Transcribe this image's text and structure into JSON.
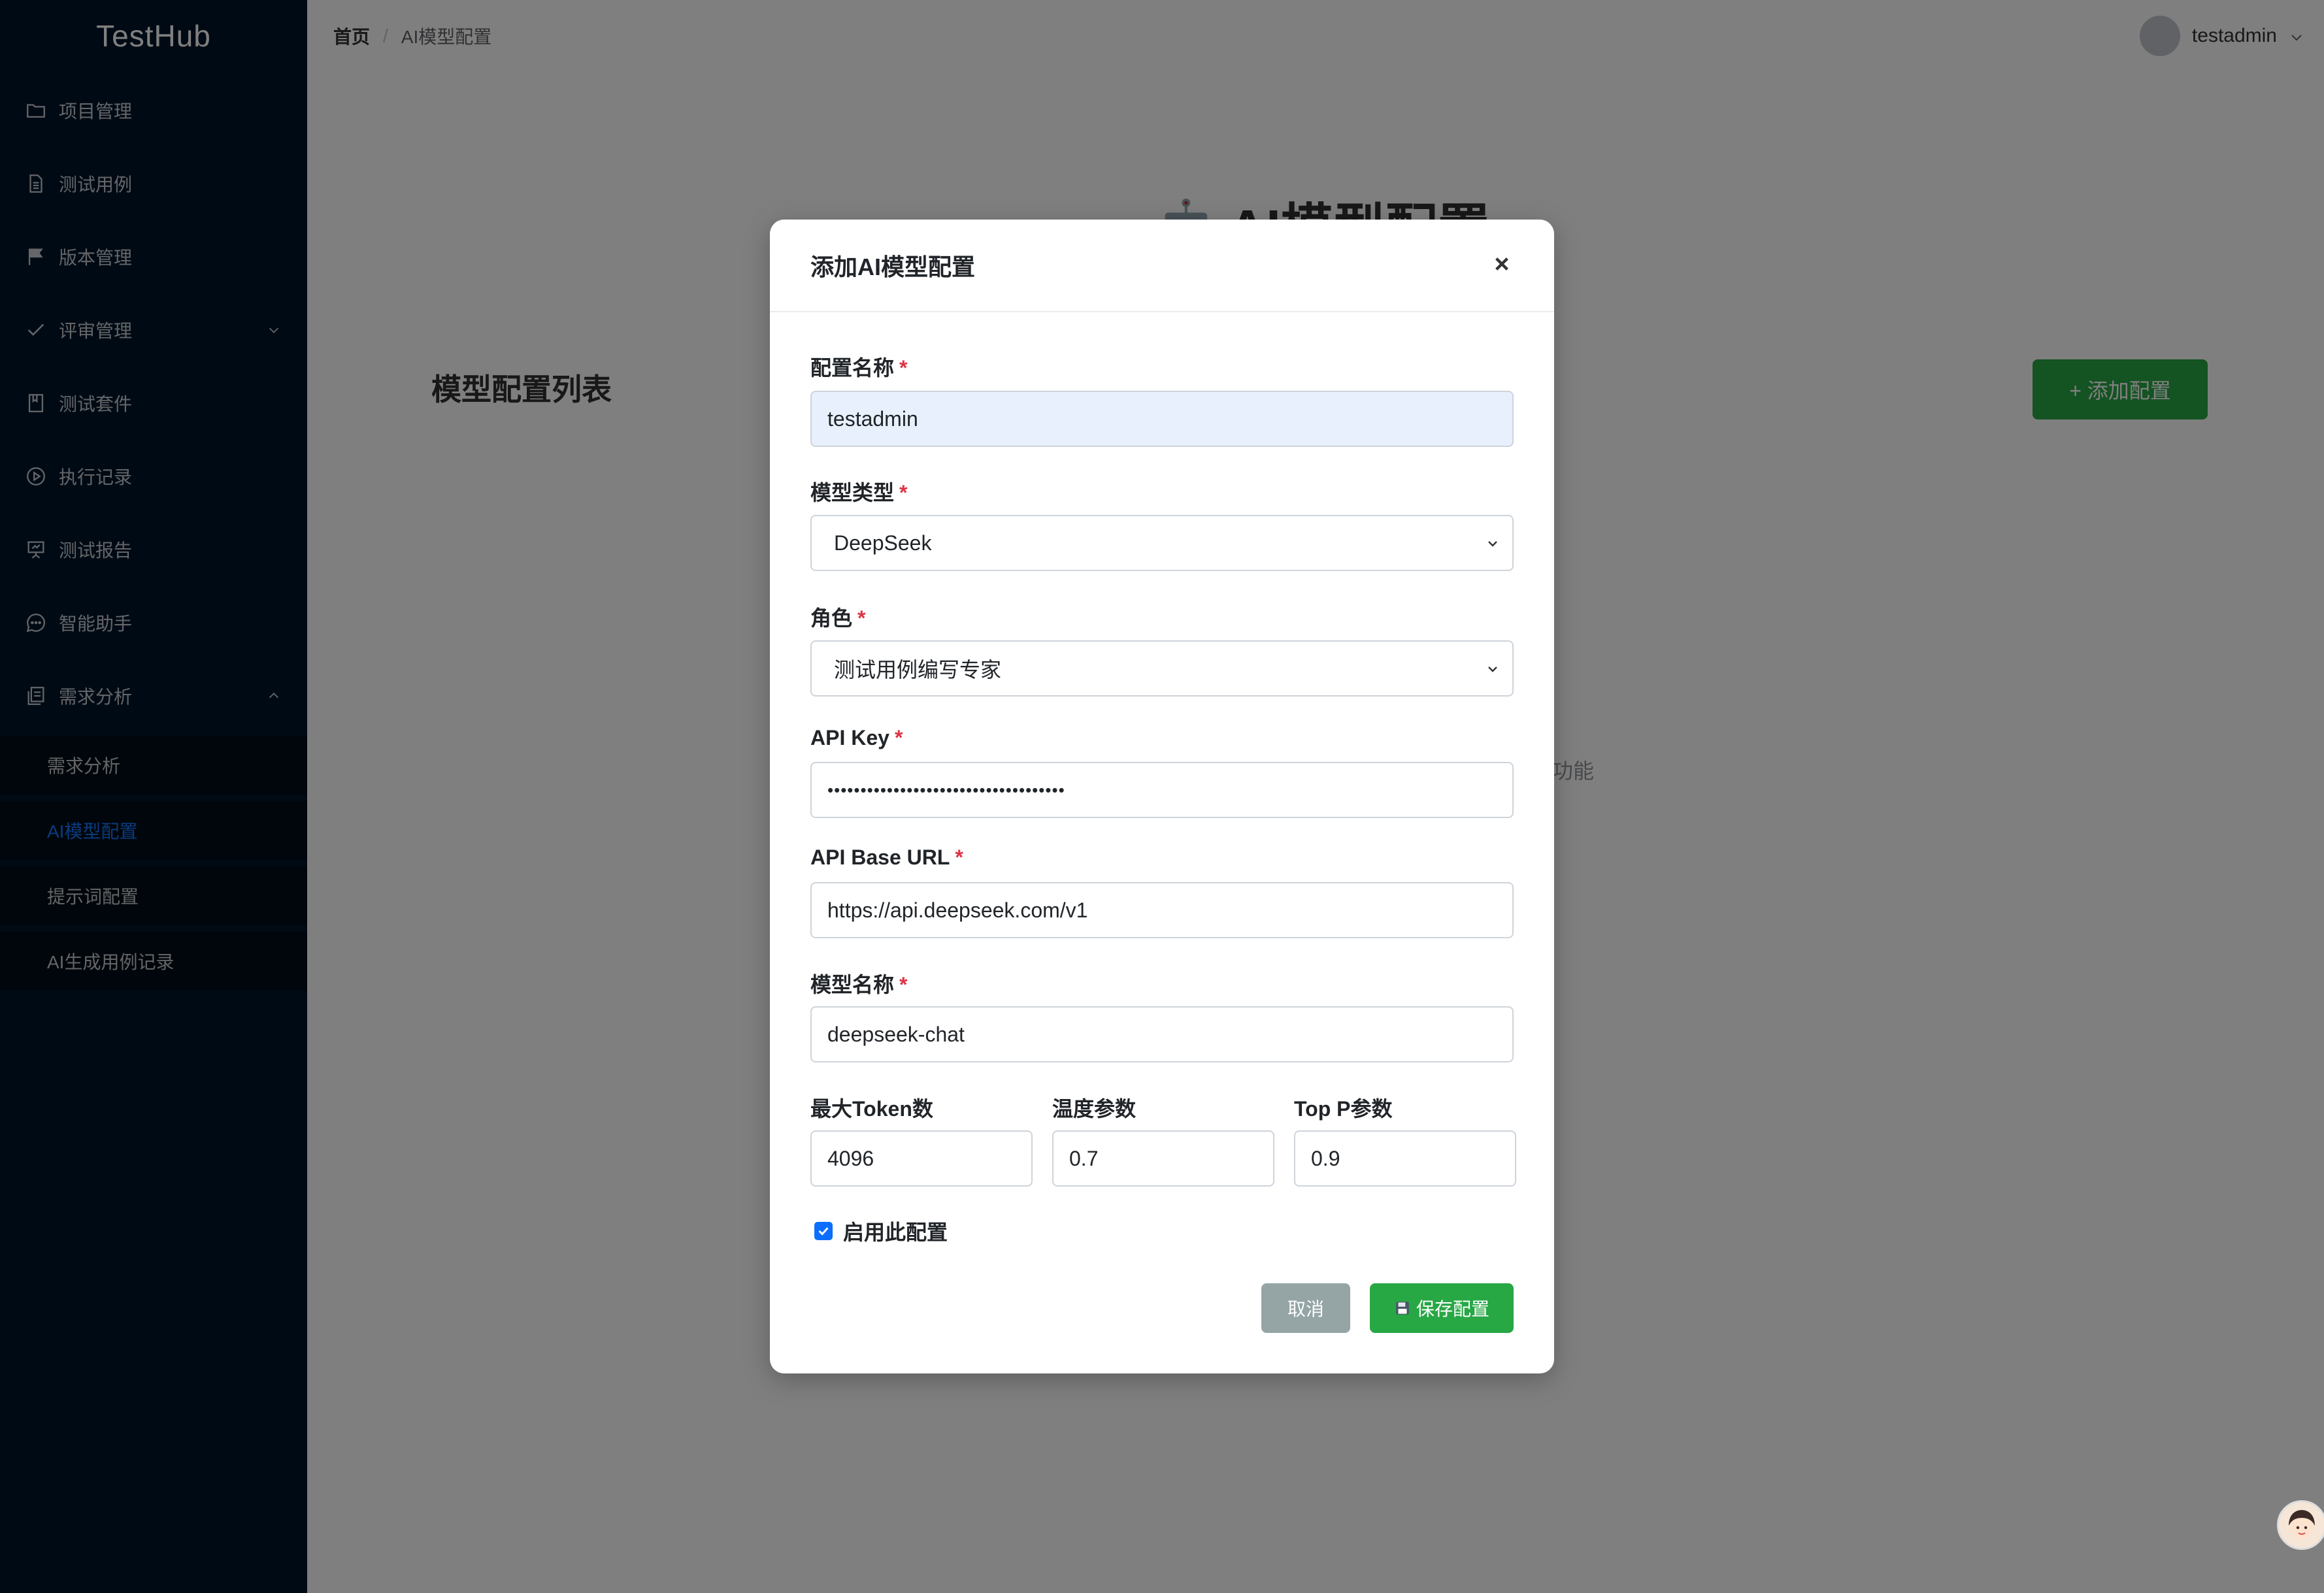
{
  "app": {
    "logo": "TestHub"
  },
  "sidebar": {
    "items": [
      {
        "label": "项目管理",
        "icon": "folder-icon"
      },
      {
        "label": "测试用例",
        "icon": "document-icon"
      },
      {
        "label": "版本管理",
        "icon": "flag-icon"
      },
      {
        "label": "评审管理",
        "icon": "check-icon",
        "expandable": true
      },
      {
        "label": "测试套件",
        "icon": "book-icon"
      },
      {
        "label": "执行记录",
        "icon": "play-circle-icon"
      },
      {
        "label": "测试报告",
        "icon": "presentation-icon"
      },
      {
        "label": "智能助手",
        "icon": "chat-icon"
      },
      {
        "label": "需求分析",
        "icon": "analysis-icon",
        "expanded": true
      }
    ],
    "subitems": [
      {
        "label": "需求分析",
        "active": false
      },
      {
        "label": "AI模型配置",
        "active": true
      },
      {
        "label": "提示词配置",
        "active": false
      },
      {
        "label": "AI生成用例记录",
        "active": false
      }
    ]
  },
  "header": {
    "breadcrumb": {
      "home": "首页",
      "separator": "/",
      "current": "AI模型配置"
    },
    "user": {
      "name": "testadmin"
    }
  },
  "page": {
    "title": "AI模型配置",
    "list_title": "模型配置列表",
    "add_button": "+ 添加配置",
    "hint_partial": "功能"
  },
  "modal": {
    "title": "添加AI模型配置",
    "required_mark": "*",
    "fields": {
      "config_name": {
        "label": "配置名称",
        "value": "testadmin"
      },
      "model_type": {
        "label": "模型类型",
        "value": "DeepSeek"
      },
      "role": {
        "label": "角色",
        "value": "测试用例编写专家"
      },
      "api_key": {
        "label": "API Key",
        "value": "••••••••••••••••••••••••••••••••••••"
      },
      "api_base_url": {
        "label": "API Base URL",
        "value": "https://api.deepseek.com/v1"
      },
      "model_name": {
        "label": "模型名称",
        "value": "deepseek-chat"
      },
      "max_tokens": {
        "label": "最大Token数",
        "value": "4096"
      },
      "temperature": {
        "label": "温度参数",
        "value": "0.7"
      },
      "top_p": {
        "label": "Top P参数",
        "value": "0.9"
      }
    },
    "enable": {
      "label": "启用此配置",
      "checked": true
    },
    "cancel_label": "取消",
    "save_label": "保存配置"
  },
  "colors": {
    "sidebar_bg": "#001529",
    "active_menu": "#1677ff",
    "primary_green": "#28a745",
    "cancel_gray": "#95a5a6",
    "required_red": "#dc3545",
    "checkbox_blue": "#0d6efd"
  }
}
